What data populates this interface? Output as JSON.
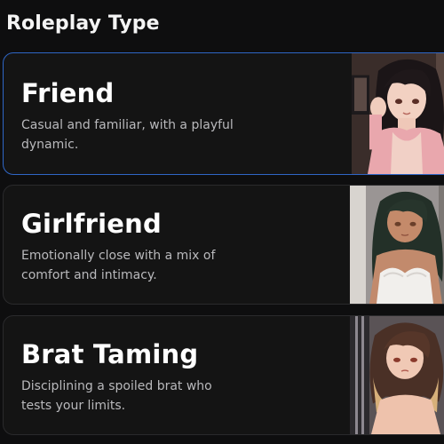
{
  "section": {
    "title": "Roleplay Type"
  },
  "options": [
    {
      "title": "Friend",
      "description": "Casual and familiar, with a playful dynamic.",
      "selected": true,
      "image": "anime-girl-pink-cardigan-portrait"
    },
    {
      "title": "Girlfriend",
      "description": "Emotionally close with a mix of comfort and intimacy.",
      "selected": false,
      "image": "anime-girl-white-lace-portrait"
    },
    {
      "title": "Brat Taming",
      "description": "Disciplining a spoiled brat who tests your limits.",
      "selected": false,
      "image": "anime-girl-brown-hair-portrait"
    }
  ],
  "colors": {
    "background": "#0e0e0f",
    "card": "#141414",
    "selected_border": "#2f66c6",
    "muted_text": "#b9b9bc"
  }
}
